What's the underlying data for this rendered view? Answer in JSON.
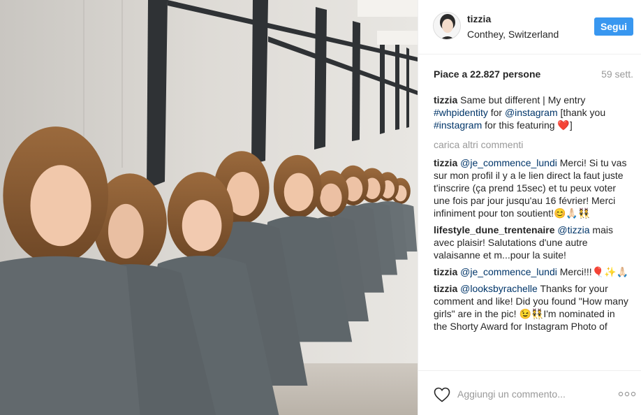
{
  "post": {
    "username": "tizzia",
    "location": "Conthey, Switzerland",
    "follow_label": "Segui",
    "likes": "Piace a 22.827 persone",
    "time": "59 sett."
  },
  "caption": {
    "user": "tizzia",
    "text1": "Same but different | My entry ",
    "tag1": "#whpidentity",
    "text2": " for ",
    "tag2": "@instagram",
    "text3": " [thank you ",
    "tag3": "#instagram",
    "text4": " for this featuring ❤️]"
  },
  "load_more": "carica altri commenti",
  "comments": [
    {
      "user": "tizzia",
      "mention": "@je_commence_lundi",
      "text": " Merci! Si tu vas sur mon profil il y a le lien direct la faut juste t'inscrire (ça prend 15sec) et tu peux voter une fois par jour jusqu'au 16 février! Merci infiniment pour ton soutient!😊🙏🏻👯"
    },
    {
      "user": "lifestyle_dune_trentenaire",
      "mention": "@tizzia",
      "text": " mais avec plaisir! Salutations d'une autre valaisanne et m...pour la suite!"
    },
    {
      "user": "tizzia",
      "mention": "@je_commence_lundi",
      "text": " Merci!!!🎈✨🙏🏻"
    },
    {
      "user": "tizzia",
      "mention": "@looksbyrachelle",
      "text": " Thanks for your comment and like! Did you found \"How many girls\" are in the pic! 😉👯I'm nominated in the Shorty Award for Instagram Photo of"
    }
  ],
  "footer": {
    "placeholder": "Aggiungi un commento...",
    "more": "ooo"
  },
  "colors": {
    "accent": "#3897f0",
    "link": "#003569",
    "muted": "#999999"
  },
  "icons": {
    "like": "heart-outline-icon",
    "more": "ellipsis-icon"
  }
}
